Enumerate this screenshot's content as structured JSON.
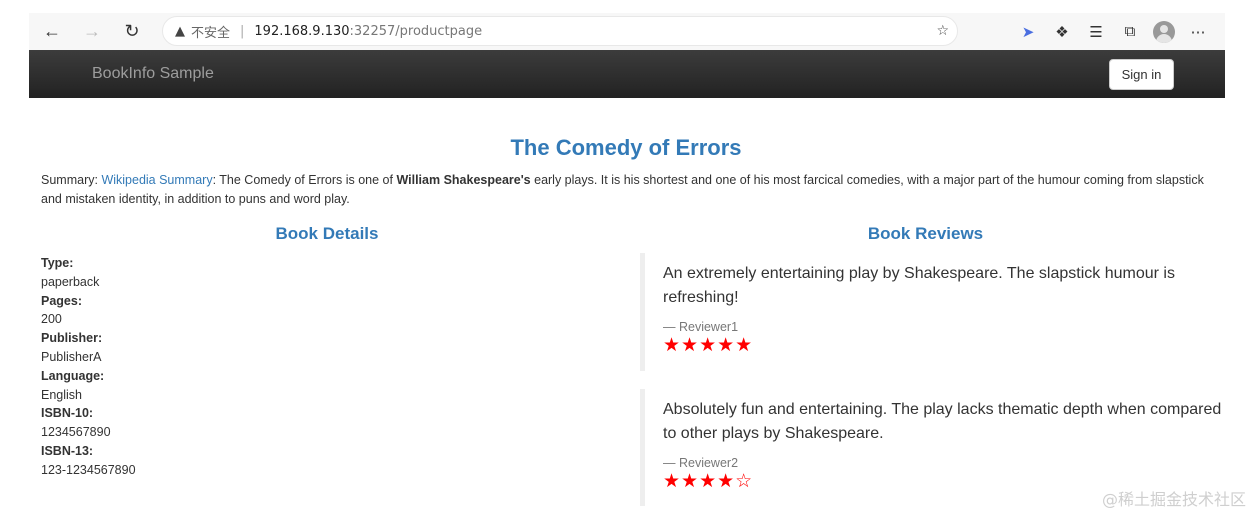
{
  "browser": {
    "security_label": "不安全",
    "url_host": "192.168.9.130",
    "url_rest": ":32257/productpage"
  },
  "navbar": {
    "brand": "BookInfo Sample",
    "signin_label": "Sign in"
  },
  "product": {
    "title": "The Comedy of Errors",
    "summary_prefix": "Summary: ",
    "summary_link": "Wikipedia Summary",
    "summary_text1": ": The Comedy of Errors is one of ",
    "summary_bold": "William Shakespeare's",
    "summary_text2": " early plays. It is his shortest and one of his most farcical comedies, with a major part of the humour coming from slapstick and mistaken identity, in addition to puns and word play."
  },
  "details": {
    "heading": "Book Details",
    "fields": [
      {
        "label": "Type:",
        "value": "paperback"
      },
      {
        "label": "Pages:",
        "value": "200"
      },
      {
        "label": "Publisher:",
        "value": "PublisherA"
      },
      {
        "label": "Language:",
        "value": "English"
      },
      {
        "label": "ISBN-10:",
        "value": "1234567890"
      },
      {
        "label": "ISBN-13:",
        "value": "123-1234567890"
      }
    ]
  },
  "reviews": {
    "heading": "Book Reviews",
    "items": [
      {
        "text": "An extremely entertaining play by Shakespeare. The slapstick humour is refreshing!",
        "reviewer": "— Reviewer1",
        "stars": "★★★★★",
        "rating": 5
      },
      {
        "text": "Absolutely fun and entertaining. The play lacks thematic depth when compared to other plays by Shakespeare.",
        "reviewer": "— Reviewer2",
        "stars": "★★★★☆",
        "rating": 4
      }
    ]
  },
  "watermark": "@稀土掘金技术社区",
  "colors": {
    "link": "#337ab7",
    "star": "#ff0000",
    "navbar": "#222222"
  }
}
